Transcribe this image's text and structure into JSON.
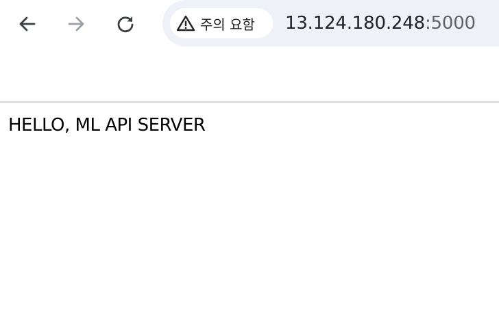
{
  "toolbar": {
    "back_icon": "arrow-left-icon",
    "forward_icon": "arrow-right-icon",
    "reload_icon": "reload-icon",
    "security_icon": "warning-triangle-icon",
    "security_label": "주의 요함",
    "url_host": "13.124.180.248",
    "url_port": ":5000"
  },
  "page": {
    "body_text": "HELLO, ML API SERVER"
  },
  "colors": {
    "omnibox_bg": "#eef1f7",
    "icon_active": "#3c4043",
    "icon_disabled": "#9aa0a6",
    "divider": "#d6d6d6"
  }
}
